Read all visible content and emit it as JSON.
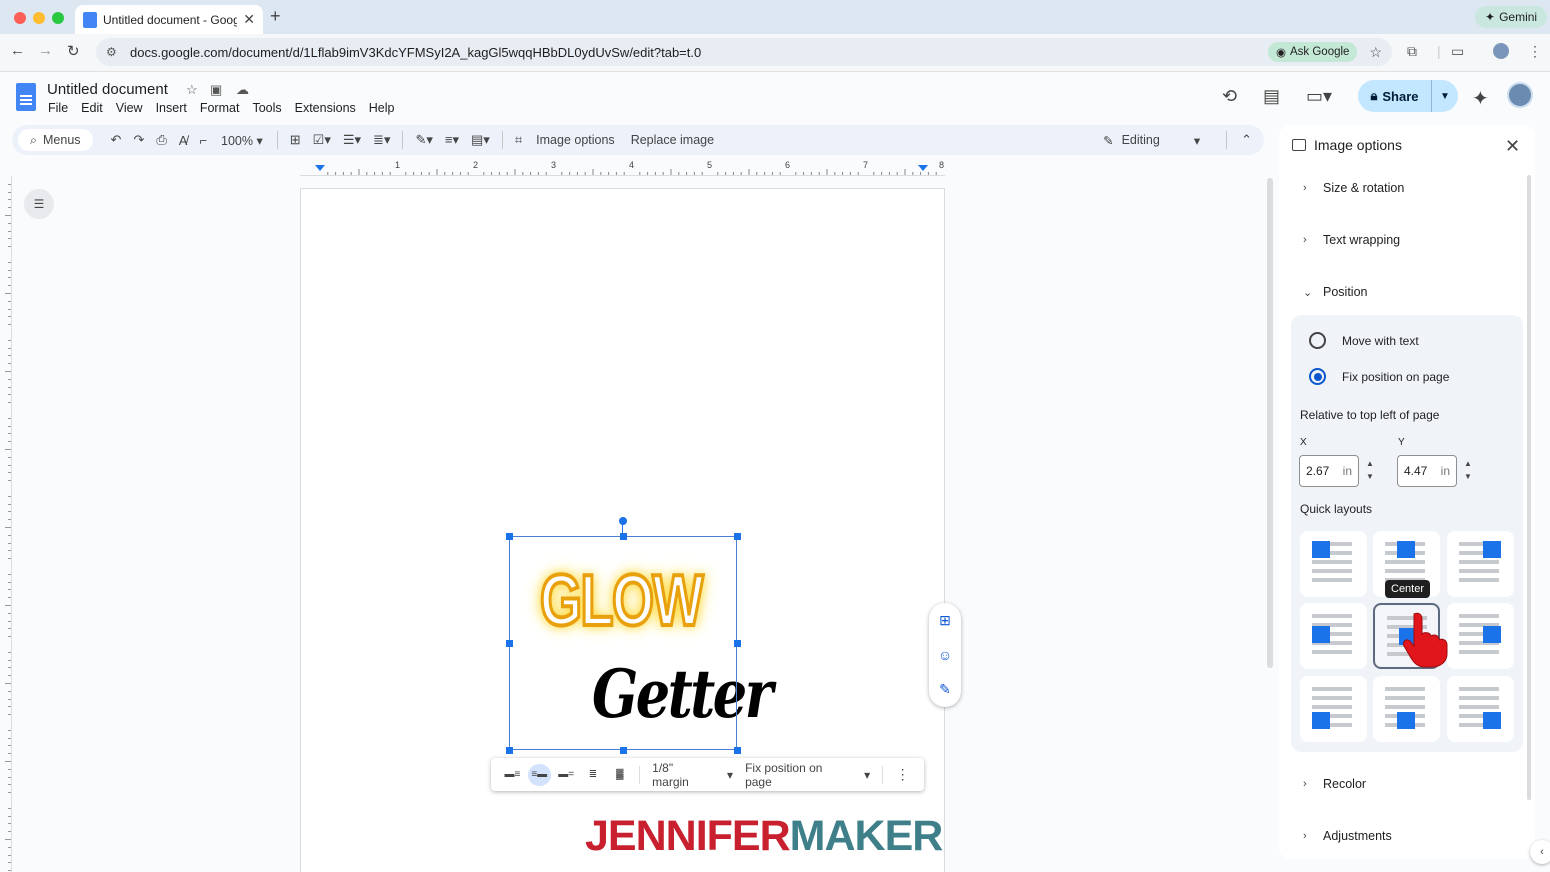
{
  "browser": {
    "tab_title": "Untitled document - Google D",
    "new_tab": "+",
    "gemini_label": "Gemini",
    "url": "docs.google.com/document/d/1Lflab9imV3KdcYFMSyI2A_kagGl5wqqHBbDL0ydUvSw/edit?tab=t.0",
    "ask_google": "Ask Google",
    "traffic_colors": [
      "#ff5f57",
      "#febc2e",
      "#28c840"
    ]
  },
  "doc": {
    "title": "Untitled document",
    "menus": [
      "File",
      "Edit",
      "View",
      "Insert",
      "Format",
      "Tools",
      "Extensions",
      "Help"
    ],
    "share_label": "Share"
  },
  "toolbar": {
    "menus_label": "Menus",
    "zoom": "100%",
    "image_options": "Image options",
    "replace_image": "Replace image",
    "editing": "Editing"
  },
  "ruler": {
    "numbers": [
      "1",
      "2",
      "3",
      "4",
      "5",
      "6",
      "7",
      "8"
    ]
  },
  "image_bar": {
    "margin": "1/8\" margin",
    "position": "Fix position on page"
  },
  "image": {
    "line1": "GLOW",
    "line2": "Getter"
  },
  "watermark": {
    "part1": "JENNIFER",
    "part2": "MAKER"
  },
  "panel": {
    "title": "Image options",
    "sections": {
      "size_rotation": "Size & rotation",
      "text_wrapping": "Text wrapping",
      "position": "Position",
      "recolor": "Recolor",
      "adjustments": "Adjustments"
    },
    "move_with_text": "Move with text",
    "fix_position": "Fix position on page",
    "fix_position_selected": true,
    "relative_label": "Relative to top left of page",
    "x_label": "X",
    "y_label": "Y",
    "x_value": "2.67",
    "y_value": "4.47",
    "unit": "in",
    "quick_layouts_label": "Quick layouts",
    "tooltip": "Center"
  },
  "colors": {
    "accent": "#1a73e8",
    "share_bg": "#c2e7ff"
  }
}
